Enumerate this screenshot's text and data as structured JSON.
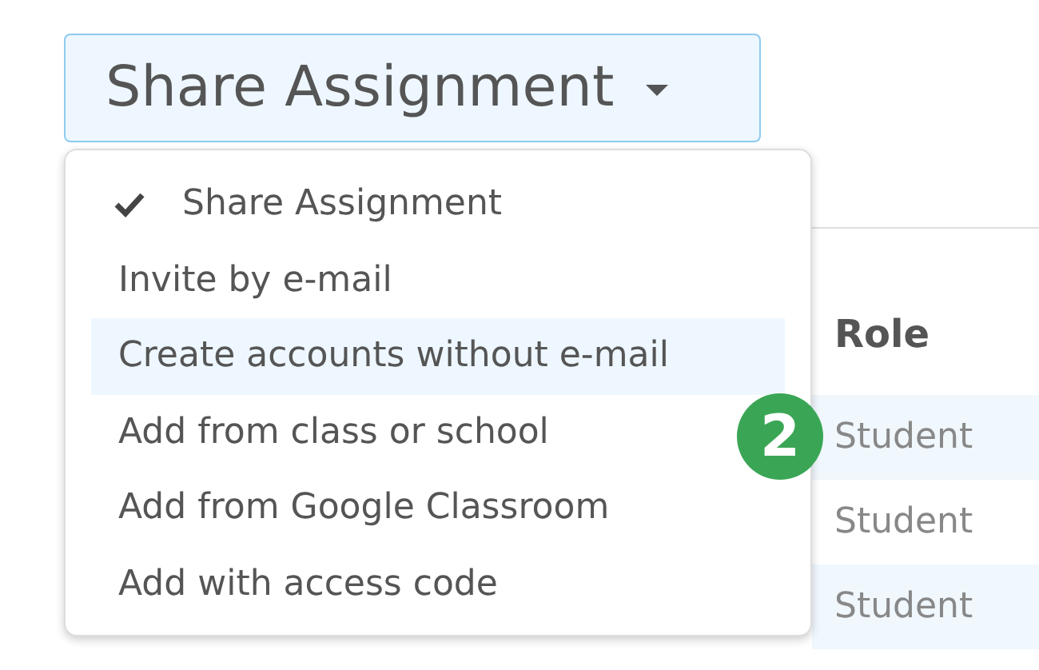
{
  "dropdown_button": {
    "label": "Share Assignment"
  },
  "menu": {
    "items": [
      {
        "label": "Share Assignment",
        "checked": true,
        "selected": false
      },
      {
        "label": "Invite by e-mail",
        "checked": false,
        "selected": false
      },
      {
        "label": "Create accounts without e-mail",
        "checked": false,
        "selected": true
      },
      {
        "label": "Add from class or school",
        "checked": false,
        "selected": false
      },
      {
        "label": "Add from Google Classroom",
        "checked": false,
        "selected": false
      },
      {
        "label": "Add with access code",
        "checked": false,
        "selected": false
      }
    ]
  },
  "step_badge": "2",
  "table": {
    "columns": [
      "Role"
    ],
    "rows": [
      {
        "role": "Student"
      },
      {
        "role": "Student"
      },
      {
        "role": "Student"
      }
    ]
  }
}
